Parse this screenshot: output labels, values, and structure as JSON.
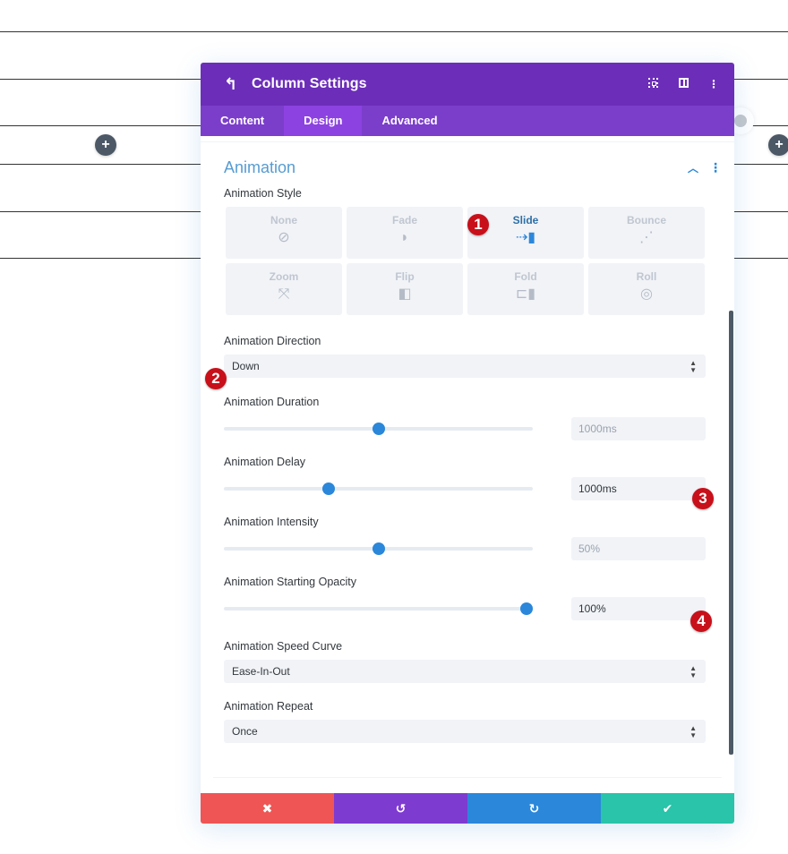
{
  "header": {
    "title": "Column Settings",
    "back_icon": "undo-arrow-icon",
    "icons": [
      "focus-mode-icon",
      "split-view-icon",
      "more-options-icon"
    ]
  },
  "tabs": [
    {
      "label": "Content",
      "active": false
    },
    {
      "label": "Design",
      "active": true
    },
    {
      "label": "Advanced",
      "active": false
    }
  ],
  "section": {
    "title": "Animation",
    "collapse_icon": "chevron-up-icon",
    "menu_icon": "more-options-icon"
  },
  "animation_style": {
    "label": "Animation Style",
    "options": [
      {
        "label": "None",
        "icon": "no-entry-icon",
        "glyph": "⊘",
        "selected": false
      },
      {
        "label": "Fade",
        "icon": "fade-icon",
        "glyph": "◗",
        "selected": false
      },
      {
        "label": "Slide",
        "icon": "slide-icon",
        "glyph": "⇢▮",
        "selected": true
      },
      {
        "label": "Bounce",
        "icon": "bounce-icon",
        "glyph": "⋰",
        "selected": false
      },
      {
        "label": "Zoom",
        "icon": "zoom-icon",
        "glyph": "⤧",
        "selected": false
      },
      {
        "label": "Flip",
        "icon": "flip-icon",
        "glyph": "◧",
        "selected": false
      },
      {
        "label": "Fold",
        "icon": "fold-icon",
        "glyph": "⊏▮",
        "selected": false
      },
      {
        "label": "Roll",
        "icon": "roll-icon",
        "glyph": "◎",
        "selected": false
      }
    ]
  },
  "animation_direction": {
    "label": "Animation Direction",
    "value": "Down"
  },
  "animation_duration": {
    "label": "Animation Duration",
    "value": "1000ms",
    "slider_fraction": 0.5,
    "is_placeholder": true
  },
  "animation_delay": {
    "label": "Animation Delay",
    "value": "1000ms",
    "slider_fraction": 0.34,
    "is_placeholder": false
  },
  "animation_intensity": {
    "label": "Animation Intensity",
    "value": "50%",
    "slider_fraction": 0.5,
    "is_placeholder": true
  },
  "animation_opacity": {
    "label": "Animation Starting Opacity",
    "value": "100%",
    "slider_fraction": 0.98,
    "is_placeholder": false
  },
  "animation_speed_curve": {
    "label": "Animation Speed Curve",
    "value": "Ease-In-Out"
  },
  "animation_repeat": {
    "label": "Animation Repeat",
    "value": "Once"
  },
  "badges": [
    "1",
    "2",
    "3",
    "4"
  ],
  "footer": {
    "cancel_icon": "close-icon",
    "undo_icon": "undo-icon",
    "redo_icon": "redo-icon",
    "save_icon": "checkmark-icon",
    "cancel_glyph": "✖",
    "undo_glyph": "↺",
    "redo_glyph": "↻",
    "save_glyph": "✔"
  },
  "colors": {
    "header": "#6c2eb9",
    "tabs": "#7b3ecb",
    "active_tab": "#8c42e0",
    "accent": "#2b87da",
    "cancel": "#ef5555",
    "undo": "#7e3bd0",
    "redo": "#2b87da",
    "save": "#29c4a9",
    "badge": "#c8101a"
  },
  "background": {
    "add_button_label": "+"
  }
}
